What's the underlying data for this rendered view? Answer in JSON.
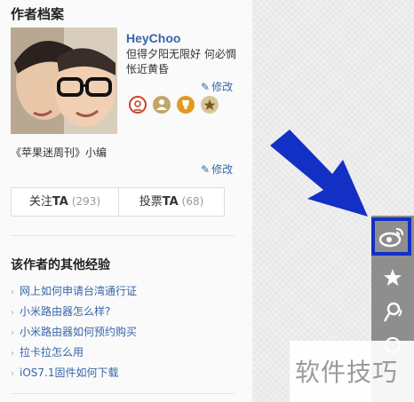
{
  "profile": {
    "section_title": "作者档案",
    "name": "HeyChoo",
    "motto": "但得夕阳无限好 何必惆怅近黄昏",
    "edit_label": "修改",
    "badges": [
      "seal-badge",
      "person-badge",
      "trophy-badge",
      "star-badge"
    ],
    "title": "《苹果迷周刊》小编",
    "title_edit_label": "修改"
  },
  "actions": {
    "follow_label": "关注",
    "follow_suffix": "TA",
    "follow_count": "(293)",
    "vote_label": "投票",
    "vote_suffix": "TA",
    "vote_count": "(68)"
  },
  "other_experiences": {
    "title": "该作者的其他经验",
    "items": [
      "网上如何申请台湾通行证",
      "小米路由器怎么样?",
      "小米路由器如何预约购买",
      "拉卡拉怎么用",
      "iOS7.1固件如何下载"
    ]
  },
  "share_toolbar": {
    "icons": [
      "weibo-icon",
      "favorite-star-icon",
      "tencent-weibo-icon"
    ],
    "highlight_color": "#1330c4",
    "arrow_color": "#1330c4"
  },
  "watermark": "软件技巧",
  "colors": {
    "link": "#3866a8",
    "toolbar": "#8e8e8e"
  }
}
